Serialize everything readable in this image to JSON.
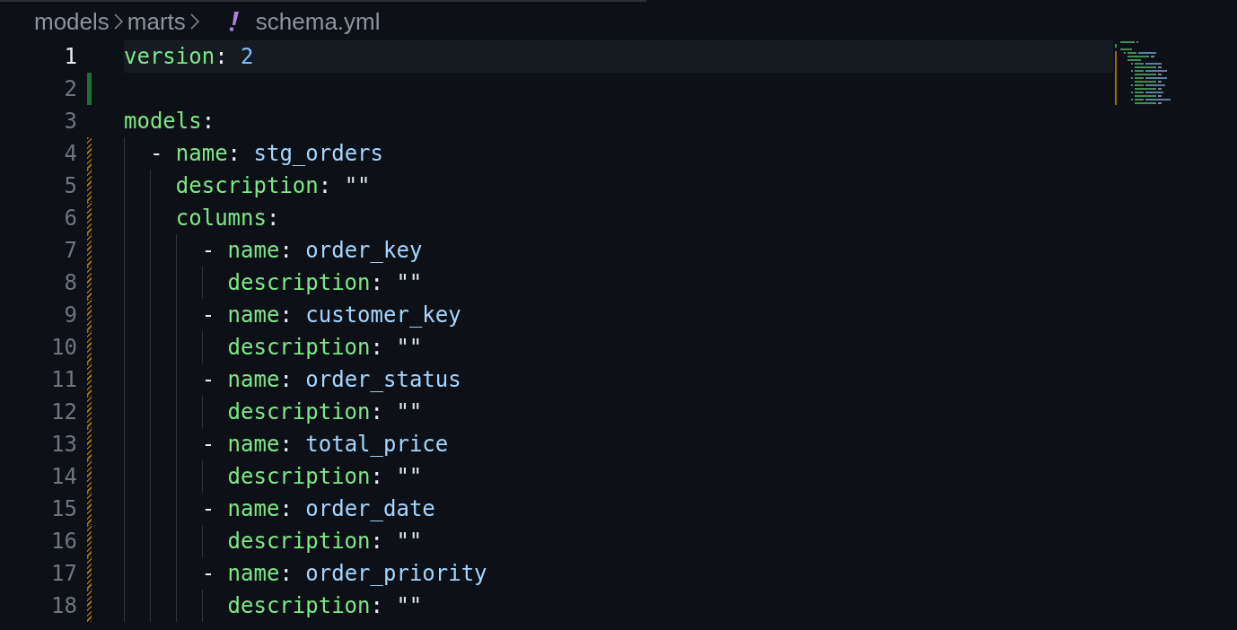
{
  "breadcrumb": [
    {
      "kind": "folder",
      "label": "models"
    },
    {
      "kind": "folder",
      "label": "marts"
    },
    {
      "kind": "file",
      "label": "schema.yml"
    }
  ],
  "editor": {
    "lines": [
      {
        "number": "1",
        "active": true,
        "added": false,
        "modified": false,
        "tokens": [
          {
            "kind": "key",
            "text": "version"
          },
          {
            "kind": "punct",
            "text": ": "
          },
          {
            "kind": "number",
            "text": "2"
          }
        ]
      },
      {
        "number": "2",
        "active": false,
        "added": true,
        "modified": false
      },
      {
        "number": "3",
        "active": false,
        "added": false,
        "modified": false,
        "tokens": [
          {
            "kind": "key",
            "text": "models"
          },
          {
            "kind": "punct",
            "text": ":"
          }
        ],
        "children": [
          {
            "number": "4",
            "active": false,
            "added": false,
            "modified": true,
            "tokens": [
              {
                "kind": "dash",
                "text": "- "
              },
              {
                "kind": "key",
                "text": "name"
              },
              {
                "kind": "punct",
                "text": ": "
              },
              {
                "kind": "scalar",
                "text": "stg_orders"
              }
            ],
            "children": [
              {
                "number": "5",
                "active": false,
                "added": false,
                "modified": true,
                "tokens": [
                  {
                    "kind": "key",
                    "text": "description"
                  },
                  {
                    "kind": "punct",
                    "text": ": "
                  },
                  {
                    "kind": "quoted",
                    "text": "\"\""
                  }
                ]
              },
              {
                "number": "6",
                "active": false,
                "added": false,
                "modified": true,
                "tokens": [
                  {
                    "kind": "key",
                    "text": "columns"
                  },
                  {
                    "kind": "punct",
                    "text": ":"
                  }
                ],
                "children": [
                  {
                    "number": "7",
                    "active": false,
                    "added": false,
                    "modified": true,
                    "tokens": [
                      {
                        "kind": "dash",
                        "text": "- "
                      },
                      {
                        "kind": "key",
                        "text": "name"
                      },
                      {
                        "kind": "punct",
                        "text": ": "
                      },
                      {
                        "kind": "scalar",
                        "text": "order_key"
                      }
                    ],
                    "children": [
                      {
                        "number": "8",
                        "active": false,
                        "added": false,
                        "modified": true,
                        "tokens": [
                          {
                            "kind": "key",
                            "text": "description"
                          },
                          {
                            "kind": "punct",
                            "text": ": "
                          },
                          {
                            "kind": "quoted",
                            "text": "\"\""
                          }
                        ]
                      }
                    ]
                  },
                  {
                    "number": "9",
                    "active": false,
                    "added": false,
                    "modified": true,
                    "tokens": [
                      {
                        "kind": "dash",
                        "text": "- "
                      },
                      {
                        "kind": "key",
                        "text": "name"
                      },
                      {
                        "kind": "punct",
                        "text": ": "
                      },
                      {
                        "kind": "scalar",
                        "text": "customer_key"
                      }
                    ],
                    "children": [
                      {
                        "number": "10",
                        "active": false,
                        "added": false,
                        "modified": true,
                        "tokens": [
                          {
                            "kind": "key",
                            "text": "description"
                          },
                          {
                            "kind": "punct",
                            "text": ": "
                          },
                          {
                            "kind": "quoted",
                            "text": "\"\""
                          }
                        ]
                      }
                    ]
                  },
                  {
                    "number": "11",
                    "active": false,
                    "added": false,
                    "modified": true,
                    "tokens": [
                      {
                        "kind": "dash",
                        "text": "- "
                      },
                      {
                        "kind": "key",
                        "text": "name"
                      },
                      {
                        "kind": "punct",
                        "text": ": "
                      },
                      {
                        "kind": "scalar",
                        "text": "order_status"
                      }
                    ],
                    "children": [
                      {
                        "number": "12",
                        "active": false,
                        "added": false,
                        "modified": true,
                        "tokens": [
                          {
                            "kind": "key",
                            "text": "description"
                          },
                          {
                            "kind": "punct",
                            "text": ": "
                          },
                          {
                            "kind": "quoted",
                            "text": "\"\""
                          }
                        ]
                      }
                    ]
                  },
                  {
                    "number": "13",
                    "active": false,
                    "added": false,
                    "modified": true,
                    "tokens": [
                      {
                        "kind": "dash",
                        "text": "- "
                      },
                      {
                        "kind": "key",
                        "text": "name"
                      },
                      {
                        "kind": "punct",
                        "text": ": "
                      },
                      {
                        "kind": "scalar",
                        "text": "total_price"
                      }
                    ],
                    "children": [
                      {
                        "number": "14",
                        "active": false,
                        "added": false,
                        "modified": true,
                        "tokens": [
                          {
                            "kind": "key",
                            "text": "description"
                          },
                          {
                            "kind": "punct",
                            "text": ": "
                          },
                          {
                            "kind": "quoted",
                            "text": "\"\""
                          }
                        ]
                      }
                    ]
                  },
                  {
                    "number": "15",
                    "active": false,
                    "added": false,
                    "modified": true,
                    "tokens": [
                      {
                        "kind": "dash",
                        "text": "- "
                      },
                      {
                        "kind": "key",
                        "text": "name"
                      },
                      {
                        "kind": "punct",
                        "text": ": "
                      },
                      {
                        "kind": "scalar",
                        "text": "order_date"
                      }
                    ],
                    "children": [
                      {
                        "number": "16",
                        "active": false,
                        "added": false,
                        "modified": true,
                        "tokens": [
                          {
                            "kind": "key",
                            "text": "description"
                          },
                          {
                            "kind": "punct",
                            "text": ": "
                          },
                          {
                            "kind": "quoted",
                            "text": "\"\""
                          }
                        ]
                      }
                    ]
                  },
                  {
                    "number": "17",
                    "active": false,
                    "added": false,
                    "modified": true,
                    "tokens": [
                      {
                        "kind": "dash",
                        "text": "- "
                      },
                      {
                        "kind": "key",
                        "text": "name"
                      },
                      {
                        "kind": "punct",
                        "text": ": "
                      },
                      {
                        "kind": "scalar",
                        "text": "order_priority"
                      }
                    ],
                    "children": [
                      {
                        "number": "18",
                        "active": false,
                        "added": false,
                        "modified": true,
                        "tokens": [
                          {
                            "kind": "key",
                            "text": "description"
                          },
                          {
                            "kind": "punct",
                            "text": ": "
                          },
                          {
                            "kind": "quoted",
                            "text": "\"\""
                          }
                        ]
                      }
                    ]
                  }
                ]
              }
            ]
          }
        ]
      }
    ]
  }
}
